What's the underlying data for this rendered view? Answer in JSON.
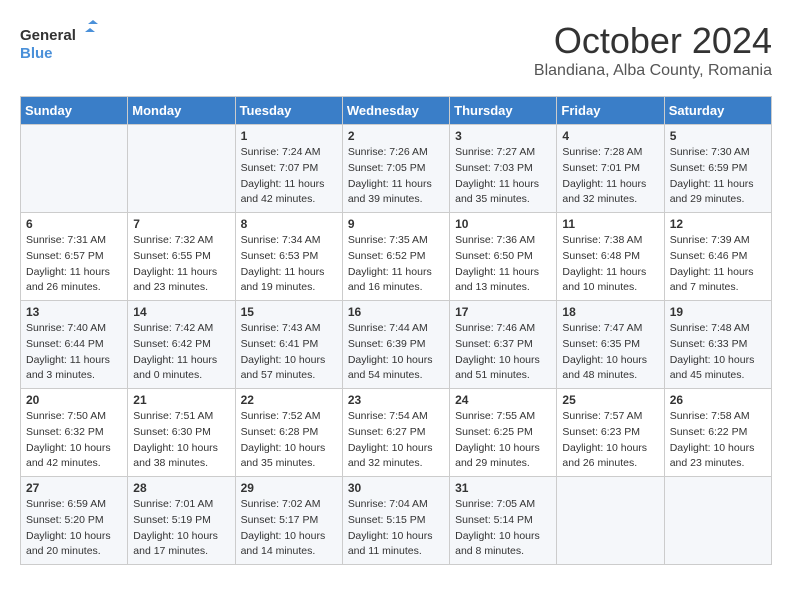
{
  "header": {
    "logo_line1": "General",
    "logo_line2": "Blue",
    "month": "October 2024",
    "location": "Blandiana, Alba County, Romania"
  },
  "weekdays": [
    "Sunday",
    "Monday",
    "Tuesday",
    "Wednesday",
    "Thursday",
    "Friday",
    "Saturday"
  ],
  "weeks": [
    [
      {
        "day": "",
        "info": ""
      },
      {
        "day": "",
        "info": ""
      },
      {
        "day": "1",
        "info": "Sunrise: 7:24 AM\nSunset: 7:07 PM\nDaylight: 11 hours and 42 minutes."
      },
      {
        "day": "2",
        "info": "Sunrise: 7:26 AM\nSunset: 7:05 PM\nDaylight: 11 hours and 39 minutes."
      },
      {
        "day": "3",
        "info": "Sunrise: 7:27 AM\nSunset: 7:03 PM\nDaylight: 11 hours and 35 minutes."
      },
      {
        "day": "4",
        "info": "Sunrise: 7:28 AM\nSunset: 7:01 PM\nDaylight: 11 hours and 32 minutes."
      },
      {
        "day": "5",
        "info": "Sunrise: 7:30 AM\nSunset: 6:59 PM\nDaylight: 11 hours and 29 minutes."
      }
    ],
    [
      {
        "day": "6",
        "info": "Sunrise: 7:31 AM\nSunset: 6:57 PM\nDaylight: 11 hours and 26 minutes."
      },
      {
        "day": "7",
        "info": "Sunrise: 7:32 AM\nSunset: 6:55 PM\nDaylight: 11 hours and 23 minutes."
      },
      {
        "day": "8",
        "info": "Sunrise: 7:34 AM\nSunset: 6:53 PM\nDaylight: 11 hours and 19 minutes."
      },
      {
        "day": "9",
        "info": "Sunrise: 7:35 AM\nSunset: 6:52 PM\nDaylight: 11 hours and 16 minutes."
      },
      {
        "day": "10",
        "info": "Sunrise: 7:36 AM\nSunset: 6:50 PM\nDaylight: 11 hours and 13 minutes."
      },
      {
        "day": "11",
        "info": "Sunrise: 7:38 AM\nSunset: 6:48 PM\nDaylight: 11 hours and 10 minutes."
      },
      {
        "day": "12",
        "info": "Sunrise: 7:39 AM\nSunset: 6:46 PM\nDaylight: 11 hours and 7 minutes."
      }
    ],
    [
      {
        "day": "13",
        "info": "Sunrise: 7:40 AM\nSunset: 6:44 PM\nDaylight: 11 hours and 3 minutes."
      },
      {
        "day": "14",
        "info": "Sunrise: 7:42 AM\nSunset: 6:42 PM\nDaylight: 11 hours and 0 minutes."
      },
      {
        "day": "15",
        "info": "Sunrise: 7:43 AM\nSunset: 6:41 PM\nDaylight: 10 hours and 57 minutes."
      },
      {
        "day": "16",
        "info": "Sunrise: 7:44 AM\nSunset: 6:39 PM\nDaylight: 10 hours and 54 minutes."
      },
      {
        "day": "17",
        "info": "Sunrise: 7:46 AM\nSunset: 6:37 PM\nDaylight: 10 hours and 51 minutes."
      },
      {
        "day": "18",
        "info": "Sunrise: 7:47 AM\nSunset: 6:35 PM\nDaylight: 10 hours and 48 minutes."
      },
      {
        "day": "19",
        "info": "Sunrise: 7:48 AM\nSunset: 6:33 PM\nDaylight: 10 hours and 45 minutes."
      }
    ],
    [
      {
        "day": "20",
        "info": "Sunrise: 7:50 AM\nSunset: 6:32 PM\nDaylight: 10 hours and 42 minutes."
      },
      {
        "day": "21",
        "info": "Sunrise: 7:51 AM\nSunset: 6:30 PM\nDaylight: 10 hours and 38 minutes."
      },
      {
        "day": "22",
        "info": "Sunrise: 7:52 AM\nSunset: 6:28 PM\nDaylight: 10 hours and 35 minutes."
      },
      {
        "day": "23",
        "info": "Sunrise: 7:54 AM\nSunset: 6:27 PM\nDaylight: 10 hours and 32 minutes."
      },
      {
        "day": "24",
        "info": "Sunrise: 7:55 AM\nSunset: 6:25 PM\nDaylight: 10 hours and 29 minutes."
      },
      {
        "day": "25",
        "info": "Sunrise: 7:57 AM\nSunset: 6:23 PM\nDaylight: 10 hours and 26 minutes."
      },
      {
        "day": "26",
        "info": "Sunrise: 7:58 AM\nSunset: 6:22 PM\nDaylight: 10 hours and 23 minutes."
      }
    ],
    [
      {
        "day": "27",
        "info": "Sunrise: 6:59 AM\nSunset: 5:20 PM\nDaylight: 10 hours and 20 minutes."
      },
      {
        "day": "28",
        "info": "Sunrise: 7:01 AM\nSunset: 5:19 PM\nDaylight: 10 hours and 17 minutes."
      },
      {
        "day": "29",
        "info": "Sunrise: 7:02 AM\nSunset: 5:17 PM\nDaylight: 10 hours and 14 minutes."
      },
      {
        "day": "30",
        "info": "Sunrise: 7:04 AM\nSunset: 5:15 PM\nDaylight: 10 hours and 11 minutes."
      },
      {
        "day": "31",
        "info": "Sunrise: 7:05 AM\nSunset: 5:14 PM\nDaylight: 10 hours and 8 minutes."
      },
      {
        "day": "",
        "info": ""
      },
      {
        "day": "",
        "info": ""
      }
    ]
  ]
}
